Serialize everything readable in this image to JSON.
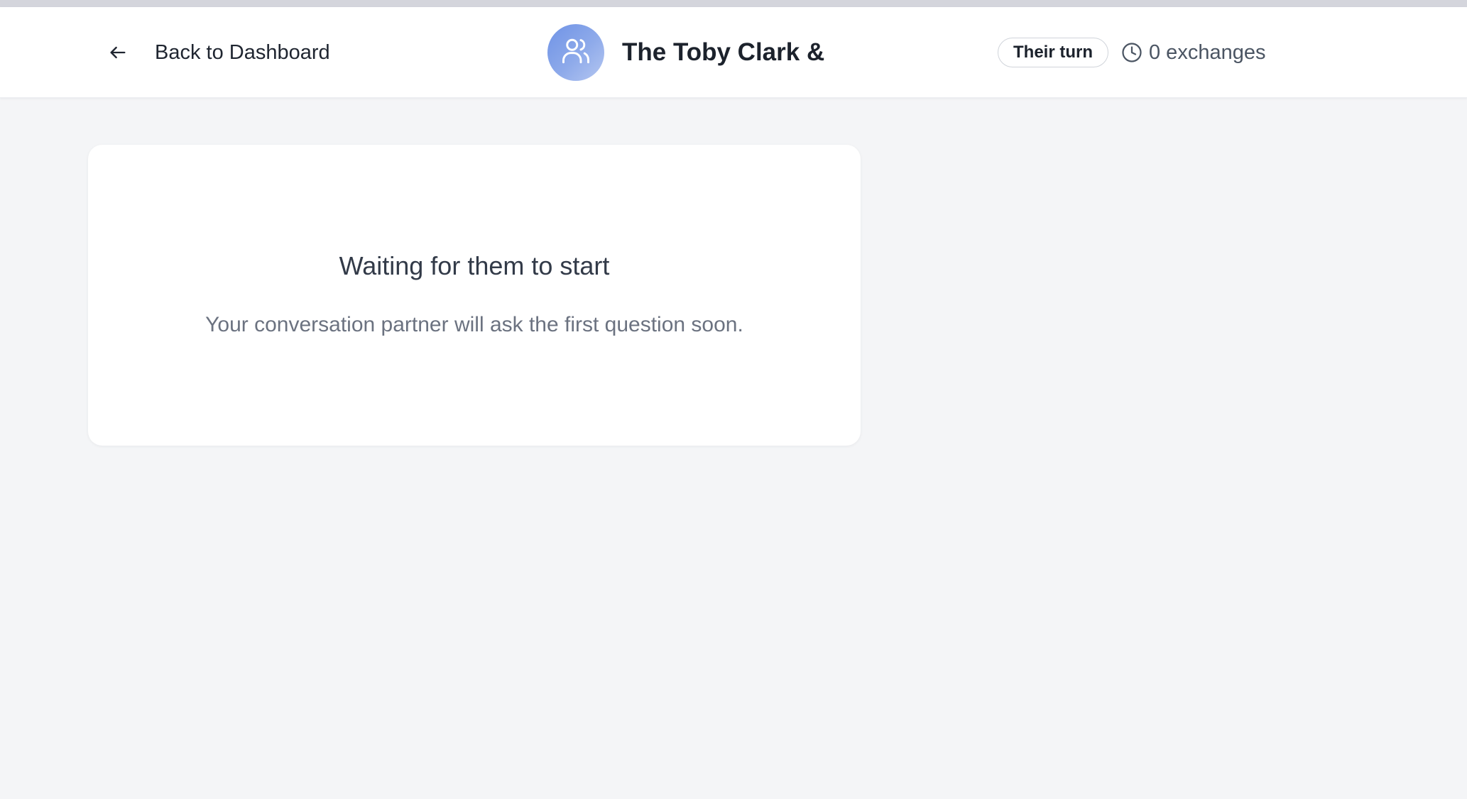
{
  "header": {
    "back_label": "Back to Dashboard",
    "back_icon": "arrow-left-icon",
    "avatar_icon": "users-icon",
    "conversation_title": "The Toby Clark &",
    "turn_badge": "Their turn",
    "exchanges_icon": "clock-icon",
    "exchanges_label": "0 exchanges"
  },
  "main": {
    "card": {
      "title": "Waiting for them to start",
      "message": "Your conversation partner will ask the first question soon."
    }
  },
  "colors": {
    "page_background": "#f4f5f7",
    "header_background": "#ffffff",
    "avatar_gradient_start": "#6f93e6",
    "avatar_gradient_end": "#b5c7f1",
    "title_text": "#1c222c",
    "muted_text": "#6b7280"
  }
}
